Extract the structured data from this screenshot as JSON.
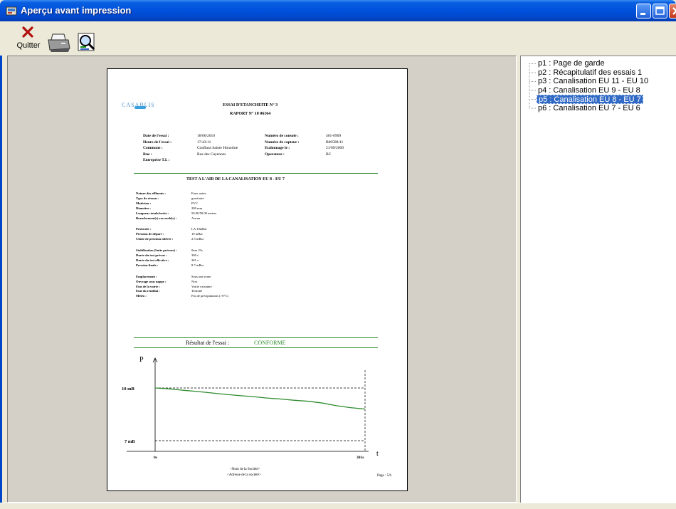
{
  "window": {
    "title": "Aperçu avant impression",
    "controls": {
      "minimize": "minimize-icon",
      "maximize": "maximize-icon",
      "close": "close-icon"
    }
  },
  "toolbar": {
    "quit_label": "Quitter",
    "quit_icon": "red-x-icon",
    "print_icon": "printer-icon",
    "zoom_icon": "zoom-icon"
  },
  "tree": {
    "items": [
      {
        "label": "p1 : Page de garde"
      },
      {
        "label": "p2 : Récapitulatif des essais 1"
      },
      {
        "label": "p3 : Canalisation EU 11 - EU 10"
      },
      {
        "label": "p4 : Canalisation EU 9 - EU 8"
      },
      {
        "label": "p5 : Canalisation EU 8 - EU 7",
        "selected": true
      },
      {
        "label": "p6 : Canalisation EU 7 - EU 6"
      }
    ]
  },
  "page": {
    "logo_text": "CASABLIS",
    "header_line1": "ESSAI D'ETANCHEITE N° 3",
    "header_line2": "RAPORT N° 10 06164",
    "info_left": [
      {
        "label": "Date de l'essai :",
        "value": "18/06/2010"
      },
      {
        "label": "Heure de l'essai :",
        "value": "17:43:11"
      },
      {
        "label": "Commune :",
        "value": "Conflans Sainte Honorine"
      },
      {
        "label": "Rue :",
        "value": "Rue des Cayennes"
      },
      {
        "label": "Entreprise T.I. :",
        "value": ""
      }
    ],
    "info_right": [
      {
        "label": "Numéro de console :",
        "value": "401-0909"
      },
      {
        "label": "Numéro de capteur :",
        "value": "B00588/11"
      },
      {
        "label": "Etalonnage le :",
        "value": "21/09/2009"
      },
      {
        "label": "Operateur :",
        "value": "BC"
      }
    ],
    "section_title": "TEST A L'AIR DE LA CANALISATION EU 8 - EU 7",
    "params_group1": [
      {
        "label": "Nature des effluents :",
        "value": "Eaux usées"
      },
      {
        "label": "Type de réseau :",
        "value": "gravitaire"
      },
      {
        "label": "Matériau :",
        "value": "PVC"
      },
      {
        "label": "Diamètre :",
        "value": "200 mm"
      },
      {
        "label": "Longueur totale/testée :",
        "value": "50.00/50.00 metres"
      },
      {
        "label": "Branchement(s) raccordé(s) :",
        "value": "Aucun"
      }
    ],
    "params_group2": [
      {
        "label": "Protocole :",
        "value": "LA 10mBar"
      },
      {
        "label": "Pression de départ :",
        "value": "10 mBar"
      },
      {
        "label": "Chute de pression tolérée :",
        "value": "2.5 mBar"
      }
    ],
    "params_group3": [
      {
        "label": "Stabilisation (Suite prévues) :",
        "value": "0mn 23s"
      },
      {
        "label": "Durée du test prévue :",
        "value": "300 s"
      },
      {
        "label": "Durée du test effective :",
        "value": "301 s"
      },
      {
        "label": "Pression finale :",
        "value": "8.7 mBar"
      }
    ],
    "params_group4": [
      {
        "label": "Emplacement :",
        "value": "Sous une route"
      },
      {
        "label": "Ouvrage sous nappe :",
        "value": "Non"
      },
      {
        "label": "Etat de la voirie :",
        "value": "Voirie existante"
      },
      {
        "label": "Etat du remblai :",
        "value": "Terminé"
      },
      {
        "label": "Météo :",
        "value": "Pas de précipitations (>0°C)"
      }
    ],
    "result_label": "Résultat de l'essai :",
    "result_value": "CONFORME",
    "footer_company": "<Nom de la Société>",
    "footer_address": "<Adresse de la société>",
    "page_number": "Page : 5/6"
  },
  "chart_data": {
    "type": "line",
    "ylabel": "P",
    "xlabel": "t",
    "y_ticks": [
      "10 mB",
      "7 mB"
    ],
    "x_ticks": [
      "0s",
      "301s"
    ],
    "ylim": [
      7,
      10
    ],
    "xlim": [
      0,
      301
    ],
    "series": [
      {
        "values_x": [
          0,
          20,
          40,
          60,
          80,
          100,
          120,
          140,
          160,
          180,
          200,
          220,
          240,
          260,
          280,
          301
        ],
        "values_y": [
          10,
          9.95,
          9.87,
          9.8,
          9.72,
          9.64,
          9.57,
          9.51,
          9.43,
          9.37,
          9.3,
          9.24,
          9.14,
          8.99,
          8.88,
          8.8
        ]
      }
    ],
    "colors": {
      "line": "#2E8B2E"
    }
  }
}
